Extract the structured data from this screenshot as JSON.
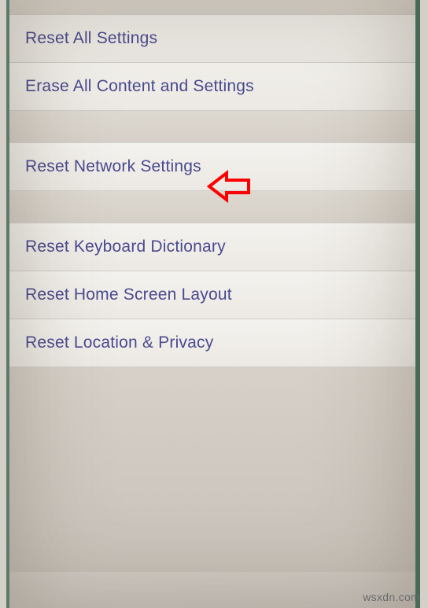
{
  "groups": [
    {
      "items": [
        {
          "label": "Reset All Settings",
          "name": "reset-all-settings-cell"
        },
        {
          "label": "Erase All Content and Settings",
          "name": "erase-all-content-cell"
        }
      ]
    },
    {
      "items": [
        {
          "label": "Reset Network Settings",
          "name": "reset-network-settings-cell",
          "highlighted": true
        }
      ]
    },
    {
      "items": [
        {
          "label": "Reset Keyboard Dictionary",
          "name": "reset-keyboard-dictionary-cell"
        },
        {
          "label": "Reset Home Screen Layout",
          "name": "reset-home-screen-layout-cell"
        },
        {
          "label": "Reset Location & Privacy",
          "name": "reset-location-privacy-cell"
        }
      ]
    }
  ],
  "annotation": {
    "color": "#ff0000"
  },
  "watermark": "wsxdn.com"
}
